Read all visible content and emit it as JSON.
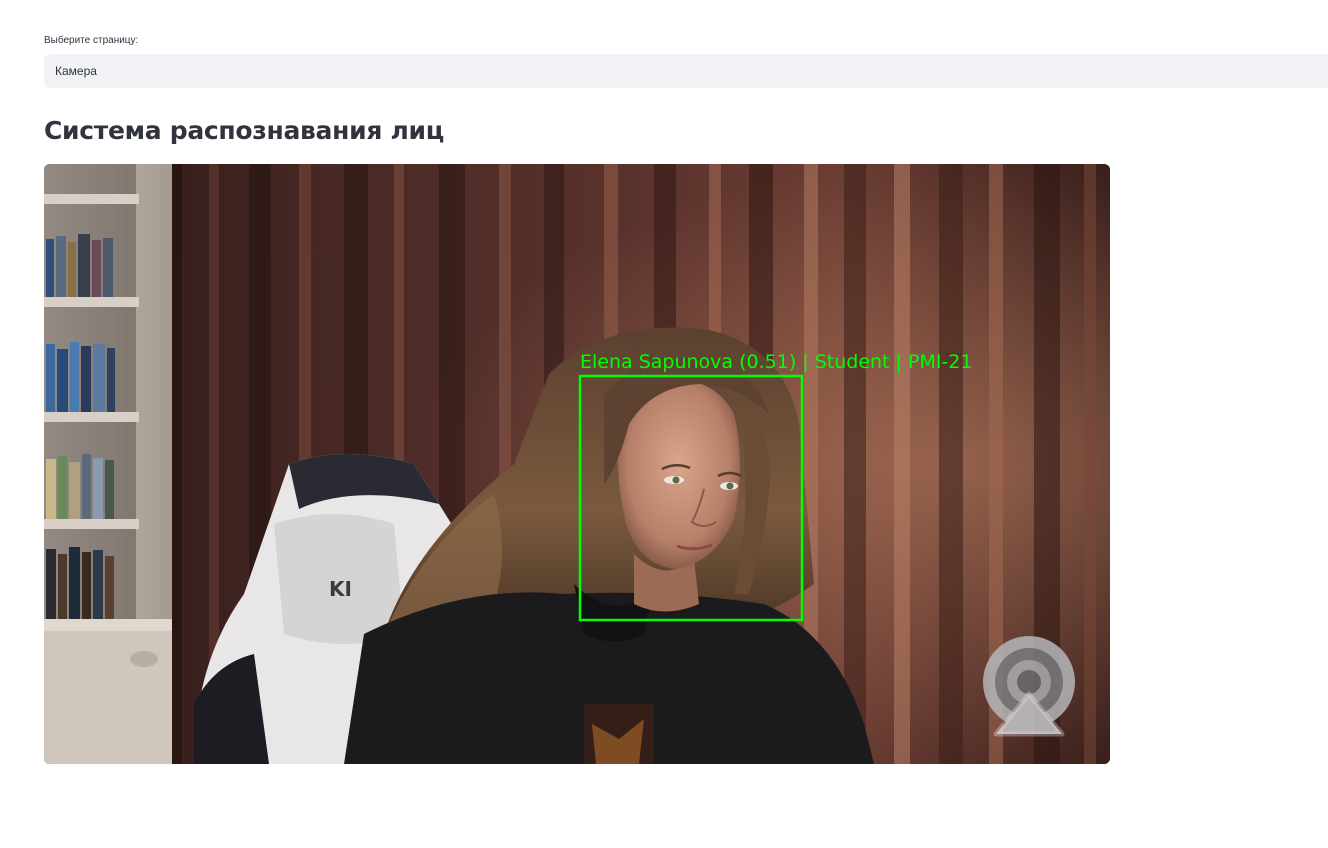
{
  "page_select": {
    "label": "Выберите страницу:",
    "value": "Камера"
  },
  "title": "Система распознавания лиц",
  "camera": {
    "detection_label": "Elena Sapunova (0.51) | Student | PMI-21",
    "box_color": "#00ff00"
  },
  "icons": {
    "stream_overlay": "broadcast-icon"
  }
}
